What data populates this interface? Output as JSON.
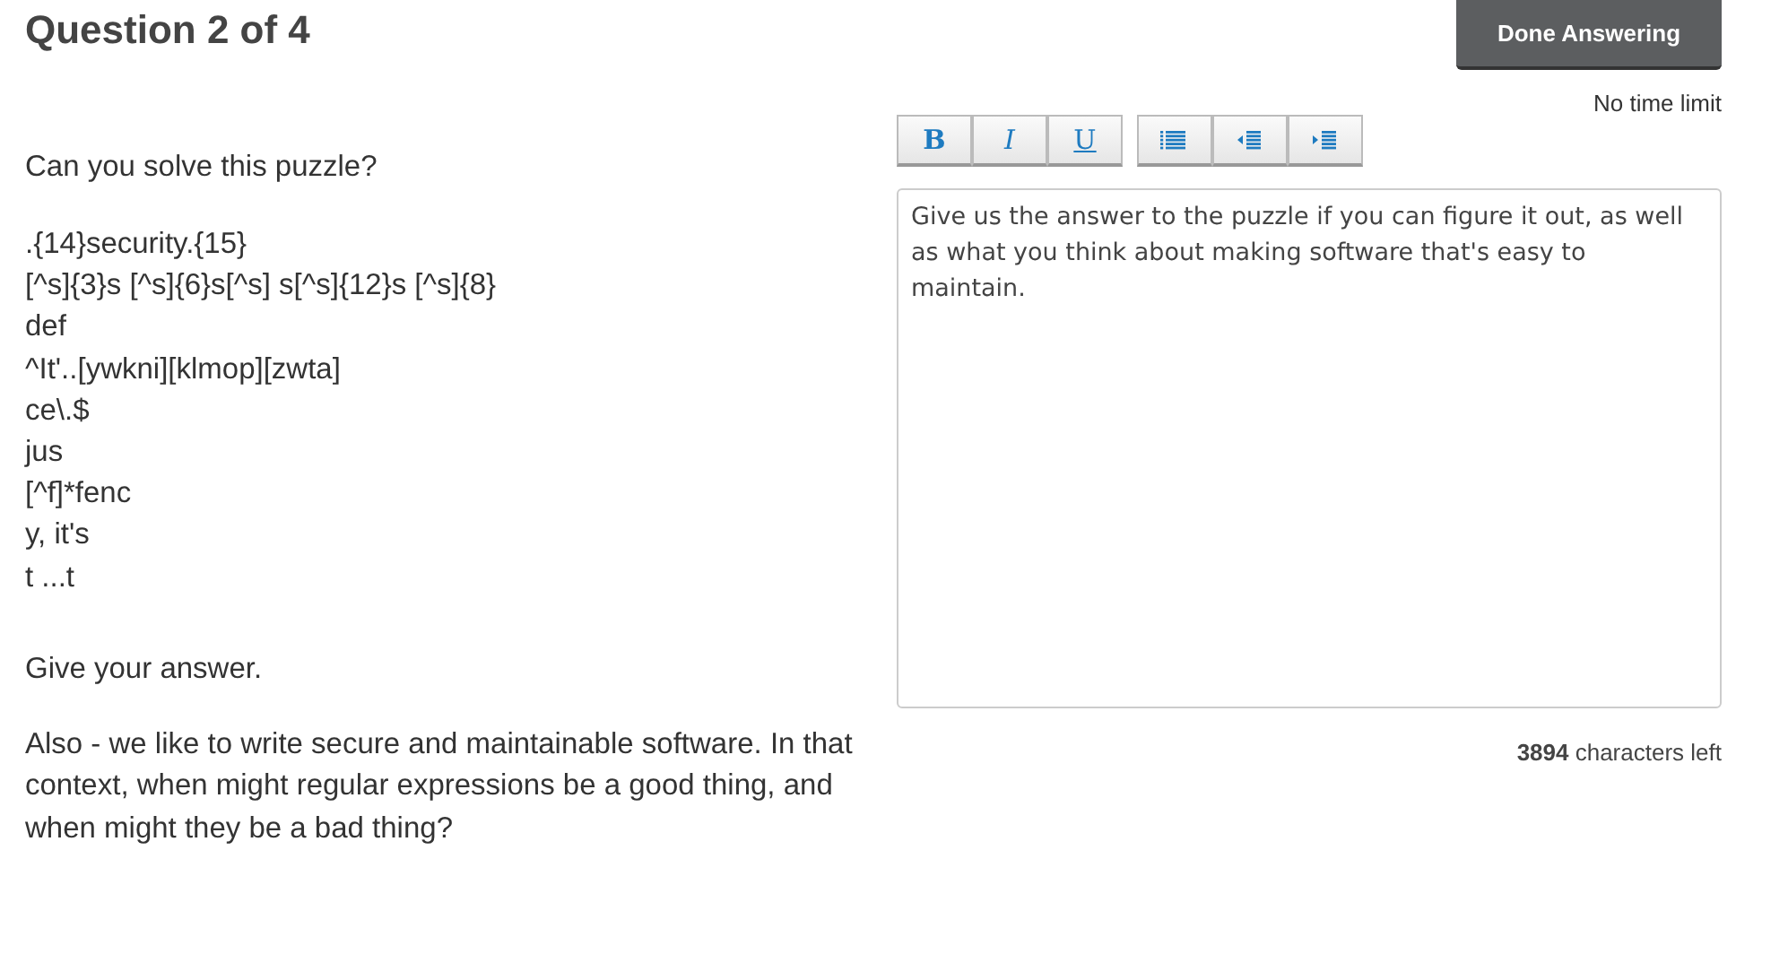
{
  "header": {
    "title": "Question 2 of 4",
    "done_button": "Done Answering",
    "time_limit": "No time limit"
  },
  "question": {
    "intro": "Can you solve this puzzle?",
    "puzzle_lines": [
      ".{14}security.{15}",
      "[^s]{3}s [^s]{6}s[^s] s[^s]{12}s [^s]{8}",
      "def",
      "^It'..[ywkni][klmop][zwta]",
      "ce\\.$",
      "jus",
      "[^f]*fenc",
      "y, it's",
      "t ...t"
    ],
    "prompt": "Give your answer.",
    "follow_up": "Also - we like to write secure and maintainable software. In that context, when might regular expressions be a good thing, and when might they be a bad thing?"
  },
  "editor": {
    "toolbar_groups": [
      [
        {
          "kind": "bold",
          "label": "B"
        },
        {
          "kind": "italic",
          "label": "I"
        },
        {
          "kind": "underline",
          "label": "U"
        }
      ],
      [
        {
          "kind": "list"
        },
        {
          "kind": "outdent"
        },
        {
          "kind": "indent"
        }
      ]
    ],
    "placeholder": "Give us the answer to the puzzle if you can figure it out, as well as what you think about making software that's easy to maintain.",
    "counter": "**3894** characters left"
  }
}
